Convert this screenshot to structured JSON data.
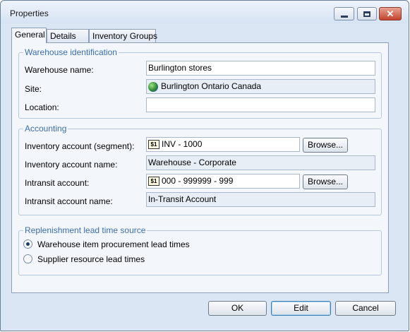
{
  "window": {
    "title": "Properties"
  },
  "tabs": [
    "General",
    "Details",
    "Inventory Groups"
  ],
  "warehouse_identification": {
    "title": "Warehouse identification",
    "warehouse_name_label": "Warehouse name:",
    "warehouse_name_value": "Burlington stores",
    "site_label": "Site:",
    "site_value": "Burlington Ontario Canada",
    "location_label": "Location:",
    "location_value": ""
  },
  "accounting": {
    "title": "Accounting",
    "inventory_account_label": "Inventory account (segment):",
    "inventory_account_value": "INV - 1000",
    "inventory_account_name_label": "Inventory account name:",
    "inventory_account_name_value": "Warehouse - Corporate",
    "intransit_account_label": "Intransit account:",
    "intransit_account_value": "000 - 999999 - 999",
    "intransit_account_name_label": "Intransit account name:",
    "intransit_account_name_value": "In-Transit Account",
    "browse_label": "Browse...",
    "segment_icon_text": "$1"
  },
  "replenishment": {
    "title": "Replenishment lead time source",
    "options": [
      {
        "label": "Warehouse item procurement lead times",
        "checked": true
      },
      {
        "label": "Supplier resource lead times",
        "checked": false
      }
    ]
  },
  "footer": {
    "ok_label": "OK",
    "edit_label": "Edit",
    "cancel_label": "Cancel"
  },
  "icons": {
    "minimize": "minimize-icon",
    "maximize": "maximize-icon",
    "close": "close-icon",
    "site": "globe-icon",
    "segment": "segment-account-icon"
  }
}
